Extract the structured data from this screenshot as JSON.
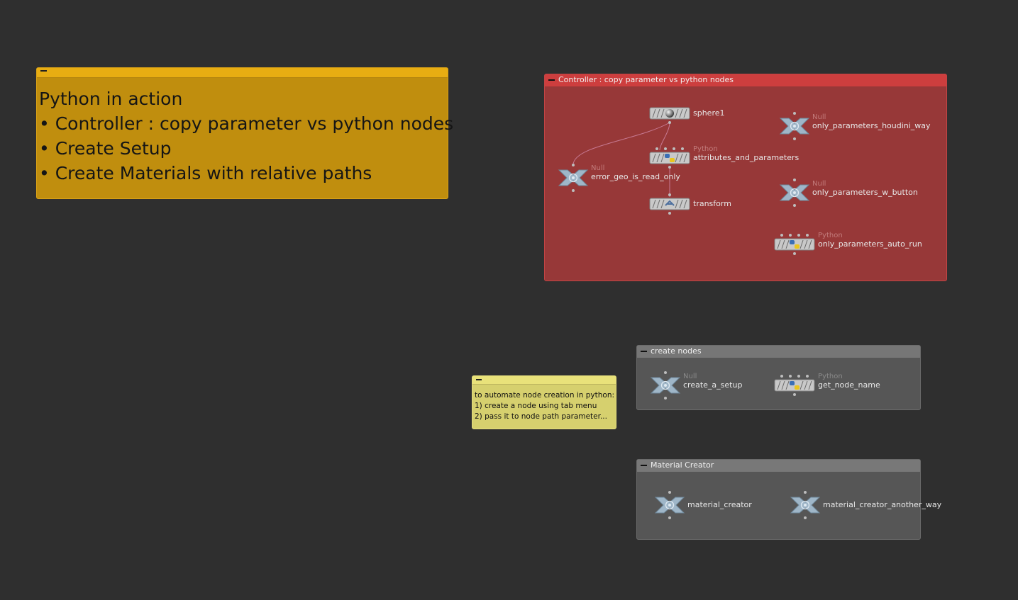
{
  "sticky_main": {
    "title": "Python in action",
    "bullets": [
      "• Controller : copy parameter vs python nodes",
      "• Create Setup",
      "• Create Materials with relative paths"
    ]
  },
  "sticky_small": {
    "lines": [
      "to automate node creation in python:",
      "1) create a node using tab menu",
      "2) pass it to node path parameter..."
    ]
  },
  "box_controller": {
    "title": "Controller : copy parameter vs python nodes",
    "nodes": {
      "sphere1": {
        "name": "sphere1",
        "icon": "sphere-icon"
      },
      "attributes_and_parameters": {
        "type": "Python",
        "name": "attributes_and_parameters",
        "icon": "python-icon"
      },
      "error_geo_is_read_only": {
        "type": "Null",
        "name": "error_geo_is_read_only",
        "icon": "null-icon"
      },
      "transform": {
        "name": "transform",
        "icon": "transform-icon"
      },
      "only_parameters_houdini_way": {
        "type": "Null",
        "name": "only_parameters_houdini_way",
        "icon": "null-icon"
      },
      "only_parameters_w_button": {
        "type": "Null",
        "name": "only_parameters_w_button",
        "icon": "null-icon"
      },
      "only_parameters_auto_run": {
        "type": "Python",
        "name": "only_parameters_auto_run",
        "icon": "python-icon"
      }
    }
  },
  "box_create_nodes": {
    "title": "create nodes",
    "nodes": {
      "create_a_setup": {
        "type": "Null",
        "name": "create_a_setup",
        "icon": "null-icon"
      },
      "get_node_name": {
        "type": "Python",
        "name": "get_node_name",
        "icon": "python-icon"
      }
    }
  },
  "box_material_creator": {
    "title": "Material Creator",
    "nodes": {
      "material_creator": {
        "name": "material_creator",
        "icon": "null-icon"
      },
      "material_creator_another_way": {
        "name": "material_creator_another_way",
        "icon": "null-icon"
      }
    }
  },
  "colors": {
    "background": "#2f2f2f",
    "sticky_orange": "#c08e0e",
    "sticky_yellow": "#d6d06e",
    "box_red": "#973838",
    "box_red_header": "#cd3e3e",
    "box_gray": "#565656",
    "node_body": "#c9c9c9",
    "null_node": "#9fb6c8",
    "wire": "#c77a93"
  }
}
